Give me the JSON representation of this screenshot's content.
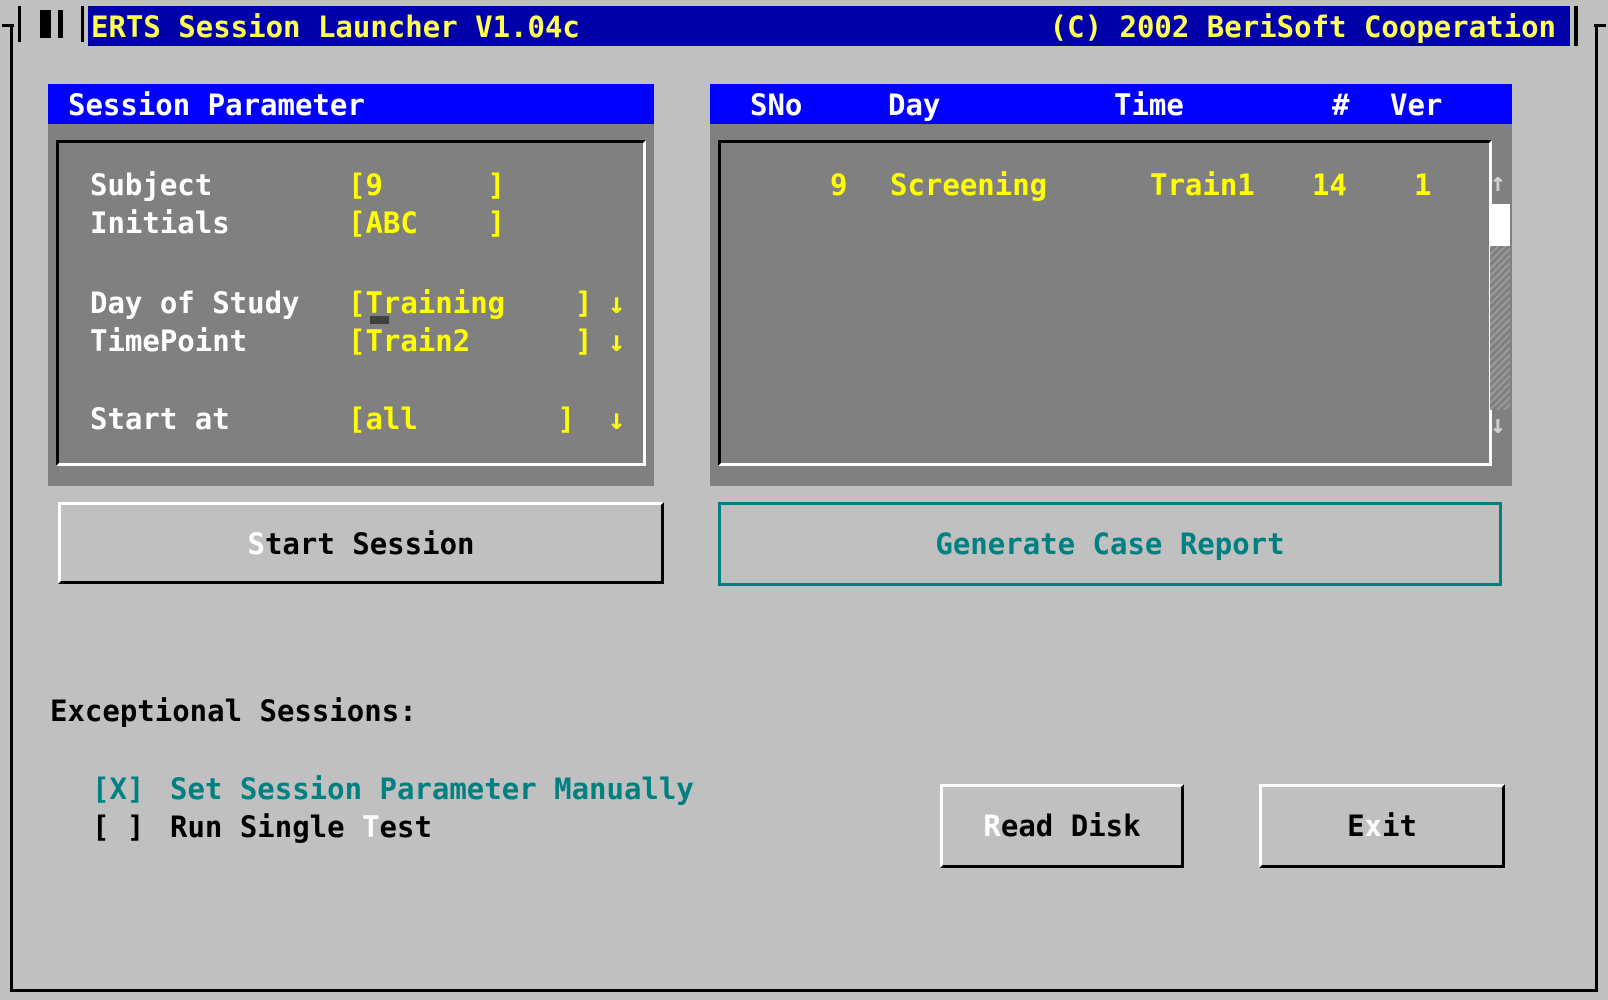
{
  "window": {
    "title": "ERTS Session Launcher V1.04c",
    "copyright": "(C) 2002 BeriSoft Cooperation"
  },
  "session_parameter": {
    "header": "Session Parameter",
    "fields": {
      "subject": {
        "label": "Subject",
        "value": "[9      ]"
      },
      "initials": {
        "label": "Initials",
        "value": "[ABC    ]"
      },
      "day_of_study": {
        "label": "Day of Study",
        "value": "[Training    ]",
        "arrow": "↓"
      },
      "timepoint": {
        "label": "TimePoint",
        "value": "[Train2      ]",
        "arrow": "↓"
      },
      "start_at": {
        "label": "Start at",
        "value": "[all        ]",
        "arrow": "↓"
      }
    }
  },
  "session_list": {
    "columns": {
      "sno": "SNo",
      "day": "Day",
      "time": "Time",
      "count": "#",
      "ver": "Ver"
    },
    "rows": [
      {
        "sno": "9",
        "day": "Screening",
        "time": "Train1",
        "count": "14",
        "ver": "1"
      }
    ],
    "scroll_up_icon": "↑",
    "scroll_down_icon": "↓"
  },
  "buttons": {
    "start_session": {
      "hotkey": "S",
      "rest": "tart Session"
    },
    "generate_case_report": "Generate Case Report",
    "read_disk": {
      "hotkey": "R",
      "rest": "ead Disk"
    },
    "exit": {
      "pre": "E",
      "hotkey": "x",
      "post": "it"
    }
  },
  "exceptional": {
    "heading": "Exceptional Sessions:",
    "set_manual": {
      "box": "[X]",
      "label": "Set Session Parameter Manually"
    },
    "single_test": {
      "box": "[ ]",
      "pre": "Run Single ",
      "hotkey": "T",
      "post": "est"
    }
  },
  "colors": {
    "titlebar": "#0000a8",
    "panel_header": "#0000ff",
    "panel_bg": "#808080",
    "value_text": "#ffff00",
    "accent_teal": "#008080",
    "desktop": "#c0c0c0"
  }
}
